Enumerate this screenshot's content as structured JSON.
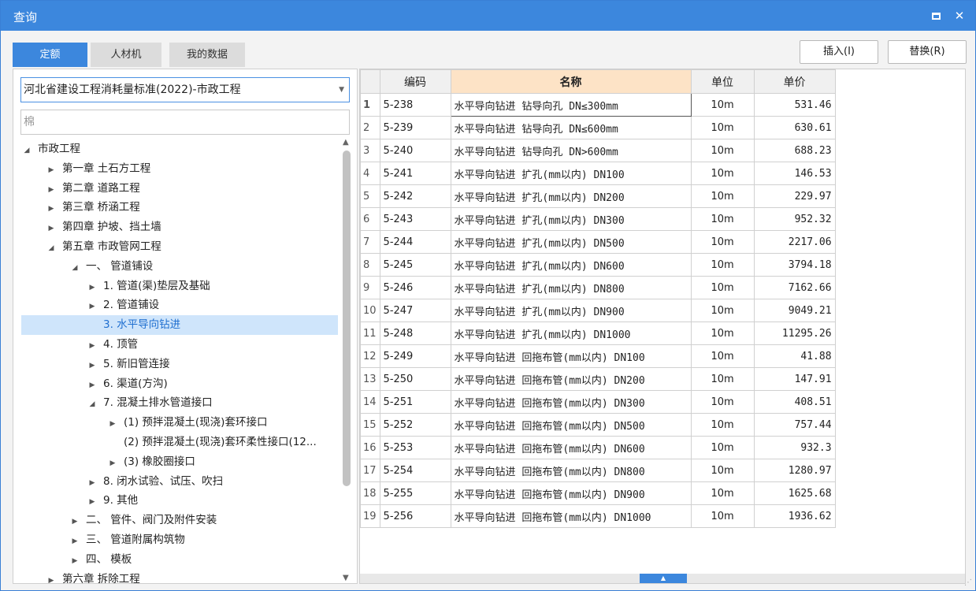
{
  "window": {
    "title": "查询"
  },
  "tabs": [
    {
      "label": "定额",
      "active": true
    },
    {
      "label": "人材机",
      "active": false
    },
    {
      "label": "我的数据",
      "active": false
    }
  ],
  "toolbar": {
    "insert_label": "插入(I)",
    "replace_label": "替换(R)"
  },
  "left": {
    "standard_select": "河北省建设工程消耗量标准(2022)-市政工程",
    "search_value": "棉"
  },
  "tree": [
    {
      "label": "市政工程",
      "level": 0,
      "toggle": "expanded"
    },
    {
      "label": "第一章 土石方工程",
      "level": 1,
      "toggle": "collapsed"
    },
    {
      "label": "第二章 道路工程",
      "level": 1,
      "toggle": "collapsed"
    },
    {
      "label": "第三章 桥涵工程",
      "level": 1,
      "toggle": "collapsed"
    },
    {
      "label": "第四章 护坡、挡土墙",
      "level": 1,
      "toggle": "collapsed"
    },
    {
      "label": "第五章 市政管网工程",
      "level": 1,
      "toggle": "expanded"
    },
    {
      "label": "一、 管道铺设",
      "level": 2,
      "toggle": "expanded"
    },
    {
      "label": "1. 管道(渠)垫层及基础",
      "level": 3,
      "toggle": "collapsed"
    },
    {
      "label": "2. 管道铺设",
      "level": 3,
      "toggle": "collapsed"
    },
    {
      "label": "3. 水平导向钻进",
      "level": 3,
      "toggle": "none",
      "selected": true
    },
    {
      "label": "4. 顶管",
      "level": 3,
      "toggle": "collapsed"
    },
    {
      "label": "5. 新旧管连接",
      "level": 3,
      "toggle": "collapsed"
    },
    {
      "label": "6. 渠道(方沟)",
      "level": 3,
      "toggle": "collapsed"
    },
    {
      "label": "7. 混凝土排水管道接口",
      "level": 3,
      "toggle": "expanded"
    },
    {
      "label": "(1) 预拌混凝土(现浇)套环接口",
      "level": 4,
      "toggle": "collapsed"
    },
    {
      "label": "(2) 预拌混凝土(现浇)套环柔性接口(12...",
      "level": 4,
      "toggle": "none"
    },
    {
      "label": "(3) 橡胶圈接口",
      "level": 4,
      "toggle": "collapsed"
    },
    {
      "label": "8. 闭水试验、试压、吹扫",
      "level": 3,
      "toggle": "collapsed"
    },
    {
      "label": "9. 其他",
      "level": 3,
      "toggle": "collapsed"
    },
    {
      "label": "二、 管件、阀门及附件安装",
      "level": 2,
      "toggle": "collapsed"
    },
    {
      "label": "三、 管道附属构筑物",
      "level": 2,
      "toggle": "collapsed"
    },
    {
      "label": "四、 模板",
      "level": 2,
      "toggle": "collapsed"
    },
    {
      "label": "第六章 拆除工程",
      "level": 1,
      "toggle": "collapsed"
    }
  ],
  "grid": {
    "headers": {
      "code": "编码",
      "name": "名称",
      "unit": "单位",
      "price": "单价"
    },
    "rows": [
      {
        "idx": "1",
        "code": "5-238",
        "name": "水平导向钻进 钻导向孔 DN≤300mm",
        "unit": "10m",
        "price": "531.46"
      },
      {
        "idx": "2",
        "code": "5-239",
        "name": "水平导向钻进 钻导向孔 DN≤600mm",
        "unit": "10m",
        "price": "630.61"
      },
      {
        "idx": "3",
        "code": "5-240",
        "name": "水平导向钻进 钻导向孔 DN>600mm",
        "unit": "10m",
        "price": "688.23"
      },
      {
        "idx": "4",
        "code": "5-241",
        "name": "水平导向钻进 扩孔(mm以内) DN100",
        "unit": "10m",
        "price": "146.53"
      },
      {
        "idx": "5",
        "code": "5-242",
        "name": "水平导向钻进 扩孔(mm以内) DN200",
        "unit": "10m",
        "price": "229.97"
      },
      {
        "idx": "6",
        "code": "5-243",
        "name": "水平导向钻进 扩孔(mm以内) DN300",
        "unit": "10m",
        "price": "952.32"
      },
      {
        "idx": "7",
        "code": "5-244",
        "name": "水平导向钻进 扩孔(mm以内) DN500",
        "unit": "10m",
        "price": "2217.06"
      },
      {
        "idx": "8",
        "code": "5-245",
        "name": "水平导向钻进 扩孔(mm以内) DN600",
        "unit": "10m",
        "price": "3794.18"
      },
      {
        "idx": "9",
        "code": "5-246",
        "name": "水平导向钻进 扩孔(mm以内) DN800",
        "unit": "10m",
        "price": "7162.66"
      },
      {
        "idx": "10",
        "code": "5-247",
        "name": "水平导向钻进 扩孔(mm以内) DN900",
        "unit": "10m",
        "price": "9049.21"
      },
      {
        "idx": "11",
        "code": "5-248",
        "name": "水平导向钻进 扩孔(mm以内) DN1000",
        "unit": "10m",
        "price": "11295.26"
      },
      {
        "idx": "12",
        "code": "5-249",
        "name": "水平导向钻进 回拖布管(mm以内) DN100",
        "unit": "10m",
        "price": "41.88"
      },
      {
        "idx": "13",
        "code": "5-250",
        "name": "水平导向钻进 回拖布管(mm以内) DN200",
        "unit": "10m",
        "price": "147.91"
      },
      {
        "idx": "14",
        "code": "5-251",
        "name": "水平导向钻进 回拖布管(mm以内) DN300",
        "unit": "10m",
        "price": "408.51"
      },
      {
        "idx": "15",
        "code": "5-252",
        "name": "水平导向钻进 回拖布管(mm以内) DN500",
        "unit": "10m",
        "price": "757.44"
      },
      {
        "idx": "16",
        "code": "5-253",
        "name": "水平导向钻进 回拖布管(mm以内) DN600",
        "unit": "10m",
        "price": "932.3"
      },
      {
        "idx": "17",
        "code": "5-254",
        "name": "水平导向钻进 回拖布管(mm以内) DN800",
        "unit": "10m",
        "price": "1280.97"
      },
      {
        "idx": "18",
        "code": "5-255",
        "name": "水平导向钻进 回拖布管(mm以内) DN900",
        "unit": "10m",
        "price": "1625.68"
      },
      {
        "idx": "19",
        "code": "5-256",
        "name": "水平导向钻进 回拖布管(mm以内) DN1000",
        "unit": "10m",
        "price": "1936.62"
      }
    ]
  },
  "colors": {
    "accent": "#3c87dd",
    "selected_row_bg": "#cfe5fb",
    "name_header_bg": "#fde3c6"
  }
}
